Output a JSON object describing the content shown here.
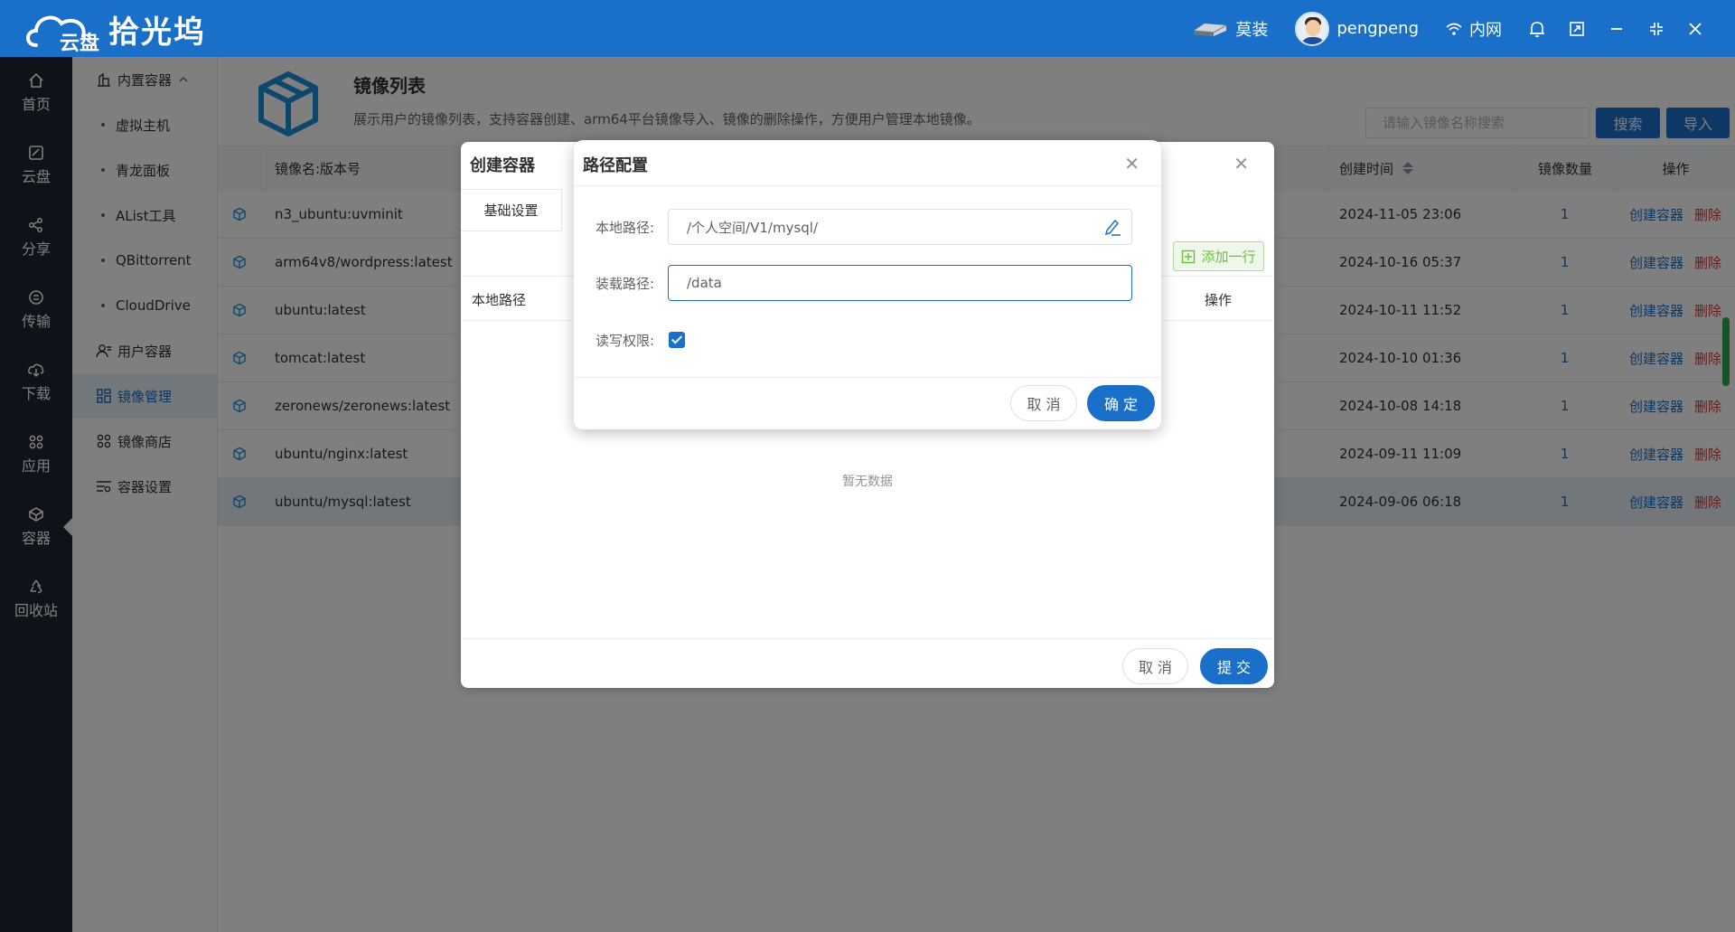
{
  "app": {
    "logo_small": "云盘",
    "logo_name": "拾光坞",
    "device_name": "莫装",
    "username": "pengpeng",
    "network": "内网"
  },
  "rail": [
    {
      "label": "首页",
      "icon": "home-icon"
    },
    {
      "label": "云盘",
      "icon": "cloud-disk-icon"
    },
    {
      "label": "分享",
      "icon": "share-icon"
    },
    {
      "label": "传输",
      "icon": "transfer-icon"
    },
    {
      "label": "下载",
      "icon": "download-icon"
    },
    {
      "label": "应用",
      "icon": "apps-icon"
    },
    {
      "label": "容器",
      "icon": "container-icon"
    },
    {
      "label": "回收站",
      "icon": "recycle-icon"
    }
  ],
  "subnav": {
    "builtin": "内置容器",
    "children": [
      "虚拟主机",
      "青龙面板",
      "AList工具",
      "QBittorrent",
      "CloudDrive"
    ],
    "user_containers": "用户容器",
    "image_mgmt": "镜像管理",
    "image_store": "镜像商店",
    "container_settings": "容器设置"
  },
  "page": {
    "title": "镜像列表",
    "description": "展示用户的镜像列表，支持容器创建、arm64平台镜像导入、镜像的删除操作，方便用户管理本地镜像。",
    "search_placeholder": "请输入镜像名称搜索",
    "search_button": "搜索",
    "import_button": "导入"
  },
  "table": {
    "headers": {
      "name": "镜像名:版本号",
      "created": "创建时间",
      "count": "镜像数量",
      "actions": "操作"
    },
    "create_label": "创建容器",
    "delete_label": "删除",
    "rows": [
      {
        "name": "n3_ubuntu:uvminit",
        "created": "2024-11-05 23:06",
        "count": "1"
      },
      {
        "name": "arm64v8/wordpress:latest",
        "created": "2024-10-16 05:37",
        "count": "1"
      },
      {
        "name": "ubuntu:latest",
        "created": "2024-10-11 11:52",
        "count": "1"
      },
      {
        "name": "tomcat:latest",
        "created": "2024-10-10 01:36",
        "count": "1"
      },
      {
        "name": "zeronews/zeronews:latest",
        "created": "2024-10-08 14:18",
        "count": "1"
      },
      {
        "name": "ubuntu/nginx:latest",
        "created": "2024-09-11 11:09",
        "count": "1"
      },
      {
        "name": "ubuntu/mysql:latest",
        "created": "2024-09-06 06:18",
        "count": "1"
      }
    ]
  },
  "create_dialog": {
    "title": "创建容器",
    "tab": "基础设置",
    "add_row": "添加一行",
    "col_local_path": "本地路径",
    "col_actions": "操作",
    "empty": "暂无数据",
    "cancel": "取 消",
    "submit": "提 交"
  },
  "path_dialog": {
    "title": "路径配置",
    "local_path_label": "本地路径:",
    "local_path_value": "/个人空间/V1/mysql/",
    "mount_path_label": "装载路径:",
    "mount_path_value": "/data",
    "rw_label": "读写权限:",
    "rw_checked": true,
    "cancel": "取 消",
    "confirm": "确 定"
  },
  "colors": {
    "primary": "#1a6fc9",
    "danger": "#e0332d",
    "success": "#67c23a",
    "rail_bg": "#1f2430"
  }
}
